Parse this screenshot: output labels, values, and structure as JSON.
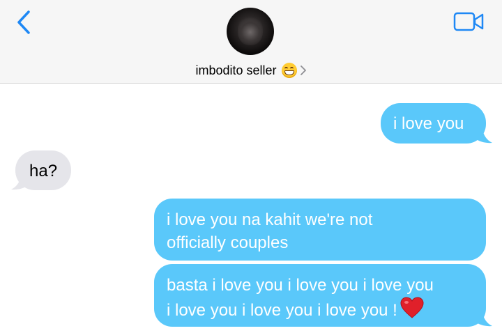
{
  "header": {
    "back_icon": "chevron-left-icon",
    "video_icon": "video-camera-icon",
    "contact_name": "imbodito seller",
    "contact_emoji": "grinning-face-icon",
    "accent_color": "#1e88f5"
  },
  "messages": [
    {
      "direction": "sent",
      "lines": [
        "i love you"
      ]
    },
    {
      "direction": "received",
      "lines": [
        "ha?"
      ]
    },
    {
      "direction": "sent",
      "lines": [
        "i love you na kahit we're not",
        "officially couples"
      ]
    },
    {
      "direction": "sent",
      "lines": [
        "basta i love you i love you i love you",
        "i love you i love you i love you !"
      ],
      "trailing_emoji": "red-heart-icon"
    }
  ],
  "colors": {
    "sent_bubble": "#5ac8fa",
    "received_bubble": "#e5e5ea",
    "header_bg": "#f6f6f6"
  }
}
